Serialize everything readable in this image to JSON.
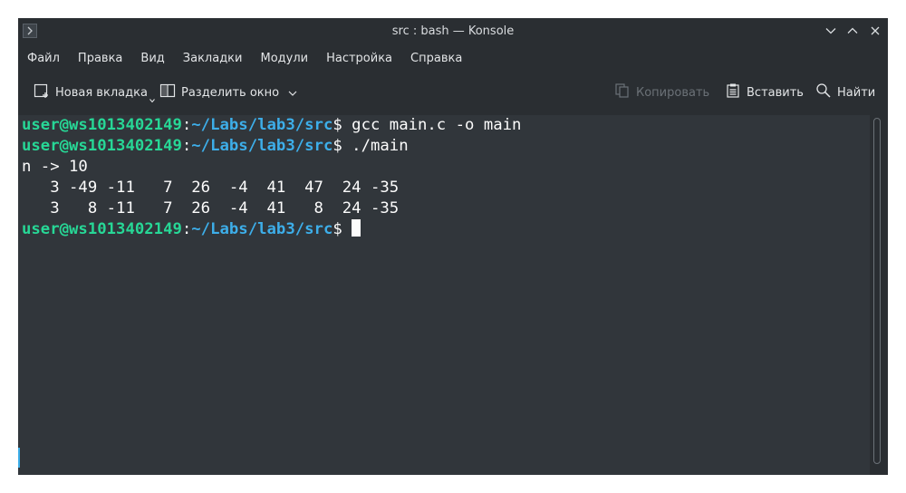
{
  "window": {
    "title": "src : bash — Konsole"
  },
  "menu": [
    "Файл",
    "Правка",
    "Вид",
    "Закладки",
    "Модули",
    "Настройка",
    "Справка"
  ],
  "toolbar": {
    "new_tab": "Новая вкладка",
    "split_view": "Разделить окно",
    "copy": "Копировать",
    "paste": "Вставить",
    "find": "Найти"
  },
  "terminal": {
    "prompt_user": "user@ws1013402149",
    "prompt_colon": ":",
    "prompt_path": "~/Labs/lab3/src",
    "prompt_symbol": "$ ",
    "commands": [
      "gcc main.c -o main",
      "./main"
    ],
    "output": [
      "n -> 10",
      "   3 -49 -11   7  26  -4  41  47  24 -35",
      "   3   8 -11   7  26  -4  41   8  24 -35"
    ]
  },
  "colors": {
    "user": "#27d796",
    "path": "#3daee9",
    "background": "#31363b",
    "text": "#fcfcfc"
  }
}
